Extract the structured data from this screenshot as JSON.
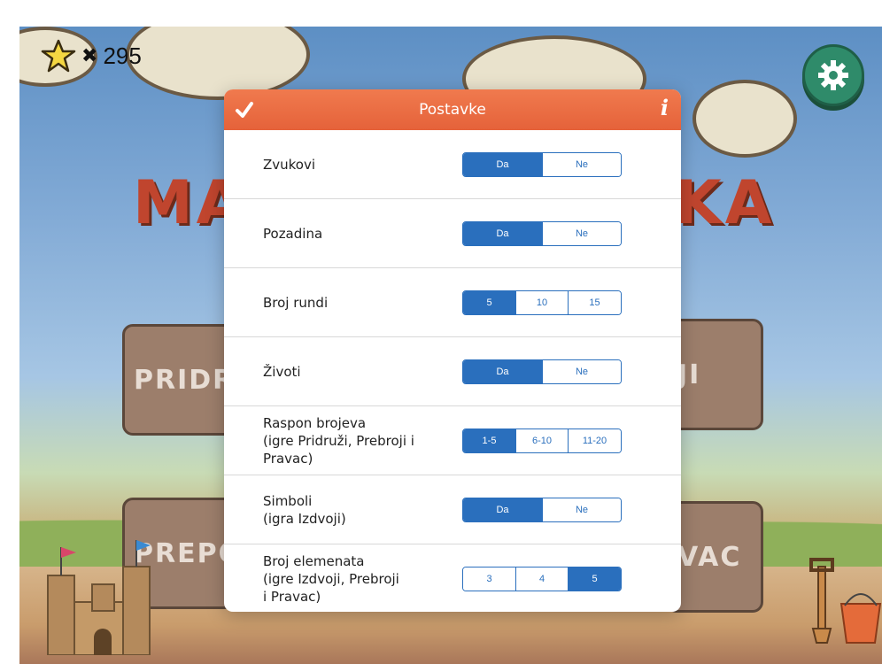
{
  "hud": {
    "score_symbol": "✖",
    "score": "295"
  },
  "background": {
    "title_line1": "MA",
    "title_line2": "KA",
    "menu_left_top": "PRIDR",
    "menu_right_top": "JI",
    "menu_left_bottom": "PREPOZ",
    "menu_right_bottom": "VAC"
  },
  "modal": {
    "title": "Postavke",
    "info_label": "i",
    "rows": [
      {
        "label": "Zvukovi",
        "options": [
          "Da",
          "Ne"
        ],
        "selected": 0
      },
      {
        "label": "Pozadina",
        "options": [
          "Da",
          "Ne"
        ],
        "selected": 0
      },
      {
        "label": "Broj rundi",
        "options": [
          "5",
          "10",
          "15"
        ],
        "selected": 0
      },
      {
        "label": "Životi",
        "options": [
          "Da",
          "Ne"
        ],
        "selected": 0
      },
      {
        "label": "Raspon brojeva\n(igre Pridruži, Prebroji i\nPravac)",
        "options": [
          "1-5",
          "6-10",
          "11-20"
        ],
        "selected": 0
      },
      {
        "label": "Simboli\n(igra Izdvoji)",
        "options": [
          "Da",
          "Ne"
        ],
        "selected": 0
      },
      {
        "label": "Broj elemenata\n(igre Izdvoji, Prebroji\ni Pravac)",
        "options": [
          "3",
          "4",
          "5"
        ],
        "selected": 2
      }
    ]
  },
  "colors": {
    "header": "#e5623a",
    "segment": "#2a6fbd",
    "gear_button": "#2f8b6a"
  },
  "icons": {
    "header_left": "checkmark-icon",
    "header_right": "info-icon",
    "hud": "star-icon",
    "top_right": "gear-icon"
  }
}
